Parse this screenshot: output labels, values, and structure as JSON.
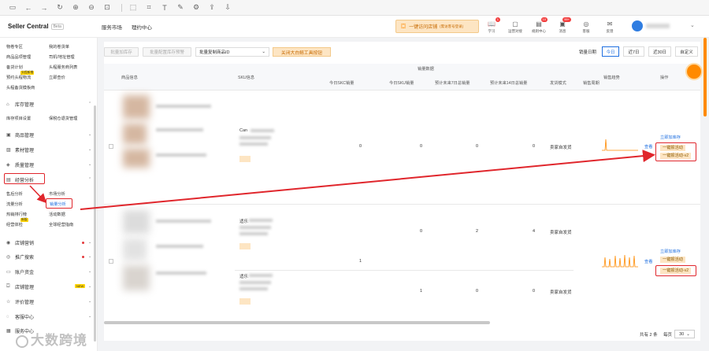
{
  "header": {
    "brand": "Seller Central",
    "beta": "Beta",
    "nav": [
      "服务市场",
      "理约中心"
    ],
    "visit_store": "一键访问店铺",
    "visit_store_sub": "(需访客号登录)",
    "icons": [
      {
        "label": "学习",
        "badge": "1",
        "icon": "book-icon"
      },
      {
        "label": "运营对接",
        "badge": "",
        "icon": "chat-icon"
      },
      {
        "label": "规则中心",
        "badge": "10",
        "icon": "rules-icon"
      },
      {
        "label": "消息",
        "badge": "99+",
        "icon": "bell-icon"
      },
      {
        "label": "客服",
        "badge": "",
        "icon": "headset-icon"
      },
      {
        "label": "反馈",
        "badge": "",
        "icon": "feedback-icon"
      }
    ]
  },
  "sidebar": {
    "top_links": [
      [
        "物卷专区",
        "我的卷货单"
      ],
      [
        "商品品项管理",
        "司机/地址管理"
      ],
      [
        "备货计划",
        "头程服务商列表"
      ],
      [
        "预约头程物流",
        "立即查价"
      ],
      [
        "头程备货模板商"
      ]
    ],
    "top_tag": "头程新增",
    "groups": {
      "inventory": "库存管理",
      "inventory_sub": [
        "库存项目设置",
        "保税仓退货管理"
      ],
      "product": "商品管理",
      "material": "素材管理",
      "quality": "质量管理",
      "ops": "经营分析",
      "ops_sub": [
        [
          "售后分析",
          "市场分析"
        ],
        [
          "流量分析",
          "销量分析"
        ],
        [
          "热销排行榜",
          "活动数据"
        ],
        [
          "经营体检",
          "全球经营指南"
        ]
      ],
      "ops_tag": "新版",
      "marketing": "店铺营销",
      "ads": "推广搜索",
      "account": "账户资金",
      "store_manage": "店铺管理",
      "store_badge": "NEW",
      "review": "评价管理",
      "service": "客服中心",
      "last": "服务中心"
    }
  },
  "toolbar": {
    "btn_add_inventory": "批量加库存",
    "btn_warning": "批量配置库存预警",
    "select_copy": "批量复制商品ID",
    "btn_close_tool": "关闭大白鲸工具按钮",
    "date_label": "销量日期",
    "date_tabs": [
      "今日",
      "近7日",
      "近30日",
      "自定义"
    ]
  },
  "table": {
    "headers": {
      "product_info": "商品信息",
      "sku_info": "SKU信息",
      "sales_group": "销量数据",
      "today_skc": "今日SKC销量",
      "today_sku": "今日SKU销量",
      "forecast7": "预计未来7日总销量",
      "forecast14": "预计未来14日总销量",
      "ship_mode": "发货模式",
      "last_week": "销售周期",
      "sales_trend": "销售趋势",
      "operation": "操作"
    },
    "rows": [
      {
        "today_skc": "0",
        "today_sku": "0",
        "forecast7": "0",
        "forecast14": "0",
        "ship_mode": "卖家自发货",
        "sku_prefix": "Can",
        "trend_link": "查看",
        "op1": "立即加库存",
        "op2": "一键报活动",
        "op3": "一键报活动-v2"
      },
      {
        "today_skc": "1",
        "today_sku": "0",
        "forecast7": "2",
        "forecast14": "4",
        "ship_mode": "卖家自发货",
        "sku_prefix": "适乐",
        "trend_link": "查看",
        "op1": "立即加库存",
        "op2": "一键报活动",
        "op3": "一键报活动-v2"
      },
      {
        "today_skc": "",
        "today_sku": "1",
        "forecast7": "0",
        "forecast14": "0",
        "ship_mode": "卖家自发货",
        "sku_prefix": "适乐",
        "trend_link": "",
        "op1": "",
        "op2": "",
        "op3": ""
      }
    ]
  },
  "pagination": {
    "total": "共有 2 条",
    "per_page_label": "每页",
    "per_page": "30"
  },
  "watermark": "大数跨境",
  "colors": {
    "accent": "#ff8a00",
    "annotation": "#e0262c",
    "link": "#1f6fe0"
  }
}
